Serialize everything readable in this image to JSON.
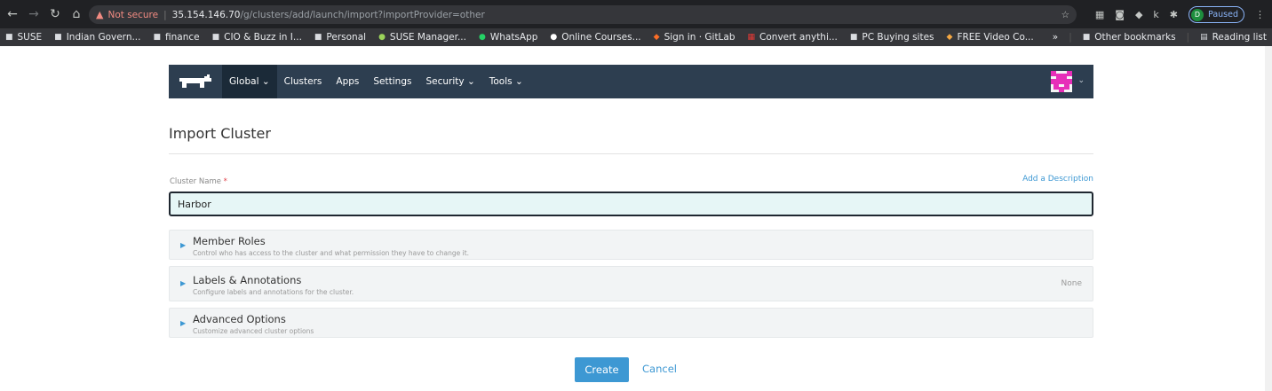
{
  "browser": {
    "nav_icons": {
      "back": "←",
      "forward": "→",
      "reload": "↻",
      "home": "⌂"
    },
    "not_secure": "Not secure",
    "url_host": "35.154.146.70",
    "url_path": "/g/clusters/add/launch/import?importProvider=other",
    "profile_initial": "D",
    "profile_status": "Paused",
    "bookmarks": [
      "SUSE",
      "Indian Govern...",
      "finance",
      "CIO & Buzz in I...",
      "Personal",
      "SUSE Manager...",
      "WhatsApp",
      "Online Courses...",
      "Sign in · GitLab",
      "Convert anythi...",
      "PC Buying sites",
      "FREE Video Co..."
    ],
    "bookmarks_more": "»",
    "other_bookmarks": "Other bookmarks",
    "reading_list": "Reading list"
  },
  "rancher_nav": {
    "items": [
      "Global",
      "Clusters",
      "Apps",
      "Settings",
      "Security",
      "Tools"
    ]
  },
  "page": {
    "title": "Import Cluster",
    "cluster_name_label": "Cluster Name",
    "required_mark": "*",
    "add_description": "Add a Description",
    "cluster_name_value": "Harbor",
    "sections": [
      {
        "title": "Member Roles",
        "desc": "Control who has access to the cluster and what permission they have to change it.",
        "status": ""
      },
      {
        "title": "Labels & Annotations",
        "desc": "Configure labels and annotations for the cluster.",
        "status": "None"
      },
      {
        "title": "Advanced Options",
        "desc": "Customize advanced cluster options",
        "status": ""
      }
    ],
    "create_label": "Create",
    "cancel_label": "Cancel"
  },
  "colors": {
    "nav_bg": "#2d3e50",
    "accent": "#3d98d3",
    "input_bg": "#e6f6f6"
  }
}
